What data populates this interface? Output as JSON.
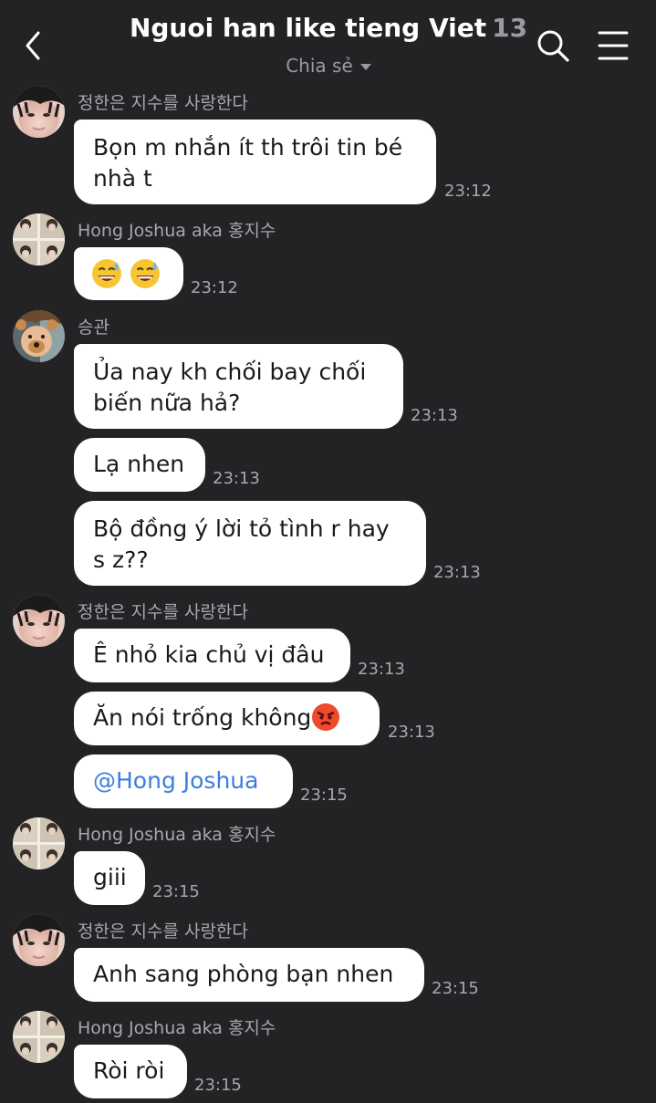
{
  "header": {
    "title": "Nguoi han like tieng Viet",
    "member_count": "13",
    "subtitle": "Chia sẻ",
    "back_icon": "chevron-left-icon",
    "search_icon": "search-icon",
    "menu_icon": "hamburger-menu-icon"
  },
  "colors": {
    "background": "#232325",
    "bubble": "#ffffff",
    "mention": "#3b7ee0",
    "muted": "#a7a7ac"
  },
  "messages": [
    {
      "sender": "정한은 지수를 사랑한다",
      "lines": [
        "Bọn m nhắn ít th trôi tin bé",
        "nhà t"
      ],
      "time": "23:12"
    },
    {
      "sender": "Hong Joshua aka 홍지수",
      "emoji": "sweat-smile-emoji x2",
      "time": "23:12"
    },
    {
      "sender": "승관",
      "lines": [
        "Ủa nay kh chối bay chối",
        "biến nữa hả?"
      ],
      "time": "23:13"
    },
    {
      "text": "Lạ nhen",
      "time": "23:13"
    },
    {
      "lines": [
        "Bộ đồng ý lời tỏ tình r hay",
        "s z??"
      ],
      "time": "23:13"
    },
    {
      "sender": "정한은 지수를 사랑한다",
      "text": "Ê nhỏ kia chủ vị đâu",
      "time": "23:13"
    },
    {
      "text": "Ăn nói trống không",
      "emoji": "angry-face-emoji",
      "time": "23:13"
    },
    {
      "mention": "@Hong Joshua",
      "time": "23:15"
    },
    {
      "sender": "Hong Joshua aka 홍지수",
      "text": "giii",
      "time": "23:15"
    },
    {
      "sender": "정한은 지수를 사랑한다",
      "text": "Anh sang phòng bạn nhen",
      "time": "23:15"
    },
    {
      "sender": "Hong Joshua aka 홍지수",
      "text": "Ròi ròi",
      "time": "23:15"
    }
  ]
}
